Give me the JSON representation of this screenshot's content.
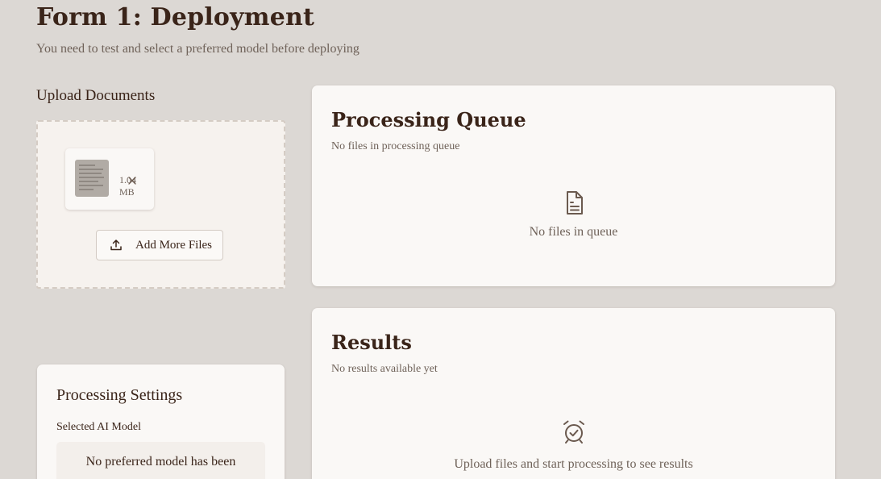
{
  "header": {
    "title": "Form 1: Deployment",
    "subtitle": "You need to test and select a preferred model before deploying"
  },
  "upload": {
    "heading": "Upload Documents",
    "file": {
      "size_value": "1.04",
      "size_unit": "MB",
      "remove_icon": "close-icon",
      "thumbnail_icon": "document-thumbnail"
    },
    "add_more_label": "Add More Files",
    "add_more_icon": "upload-icon"
  },
  "queue": {
    "title": "Processing Queue",
    "description": "No files in processing queue",
    "empty_icon": "file-text-icon",
    "empty_message": "No files in queue"
  },
  "results": {
    "title": "Results",
    "description": "No results available yet",
    "empty_icon": "alarm-check-icon",
    "empty_message": "Upload files and start processing to see results"
  },
  "settings": {
    "title": "Processing Settings",
    "model_label": "Selected AI Model",
    "model_message": "No preferred model has been"
  },
  "colors": {
    "background": "#dcd8d4",
    "card": "#faf8f6",
    "heading": "#3a2419",
    "muted": "#6f6259",
    "icon": "#6b5a4f"
  }
}
